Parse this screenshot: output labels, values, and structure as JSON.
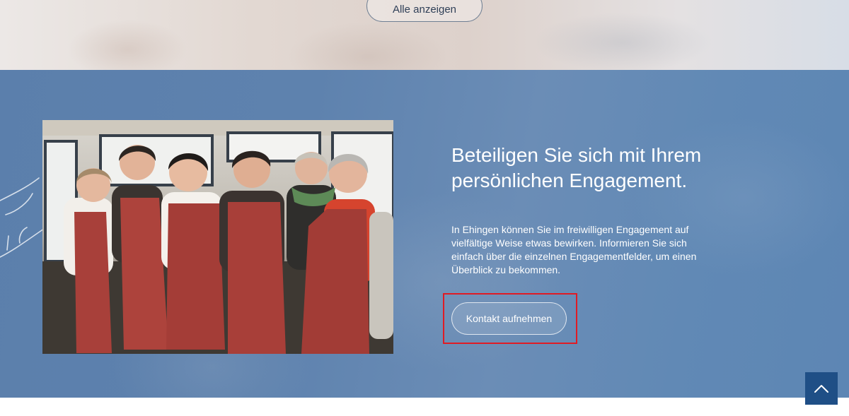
{
  "top_section": {
    "show_all_label": "Alle anzeigen"
  },
  "engagement": {
    "headline": "Beteiligen Sie sich mit Ihrem persönlichen Engagement.",
    "body": "In Ehingen können Sie im freiwilligen Engagement auf vielfältige Weise etwas bewirken. Informieren Sie sich einfach über die einzelnen Engagementfelder, um einen Überblick zu bekommen.",
    "contact_label": "Kontakt aufnehmen",
    "image_icon": "group-photo"
  },
  "scroll_top": {
    "icon": "chevron-up-icon"
  },
  "colors": {
    "section_blue": "#5e82ae",
    "scroll_button": "#1f4f86",
    "highlight_border": "#e01b24",
    "apron_red": "#a8403a"
  }
}
